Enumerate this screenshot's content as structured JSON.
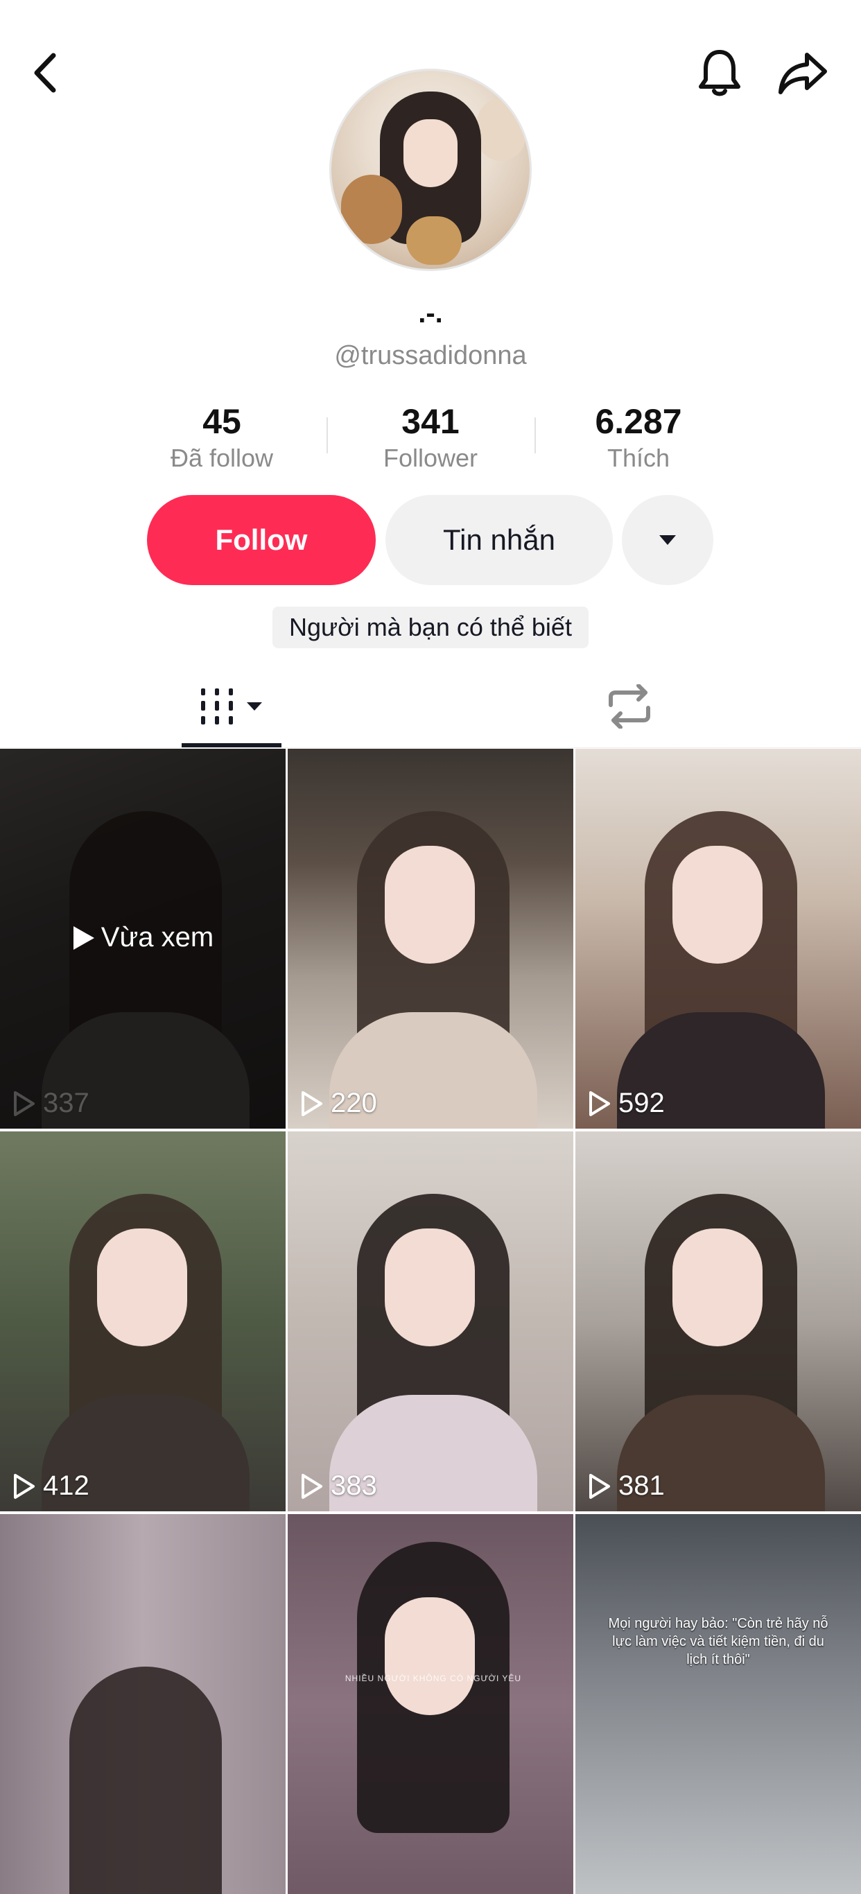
{
  "profile": {
    "display_name": ".-.",
    "handle": "@trussadidonna",
    "avatar_icon": "profile-avatar"
  },
  "header": {
    "back_icon": "chevron-left-icon",
    "bell_icon": "bell-icon",
    "share_icon": "share-arrow-icon"
  },
  "stats": [
    {
      "value": "45",
      "label": "Đã follow"
    },
    {
      "value": "341",
      "label": "Follower"
    },
    {
      "value": "6.287",
      "label": "Thích"
    }
  ],
  "actions": {
    "follow_label": "Follow",
    "message_label": "Tin nhắn",
    "more_icon": "caret-down-icon"
  },
  "suggestion_label": "Người mà bạn có thể biết",
  "tabs": {
    "videos_icon": "grid-columns-icon",
    "repost_icon": "repost-icon",
    "active": "videos"
  },
  "colors": {
    "accent": "#fe2c55",
    "button_bg": "#f1f1f2",
    "text_primary": "#161823",
    "text_secondary": "#8a8a8a"
  },
  "videos": [
    {
      "views": "337",
      "watched_label": "Vừa xem",
      "watched": true
    },
    {
      "views": "220"
    },
    {
      "views": "592"
    },
    {
      "views": "412"
    },
    {
      "views": "383"
    },
    {
      "views": "381"
    },
    {
      "views": ""
    },
    {
      "views": "",
      "overlay_small": "NHIỀU NGƯỜI KHÔNG CÓ NGƯỜI YÊU"
    },
    {
      "views": "",
      "overlay_text": "Mọi người hay bảo: \"Còn trẻ hãy nỗ lực làm việc và tiết kiệm tiền, đi du lịch ít thôi\""
    }
  ]
}
